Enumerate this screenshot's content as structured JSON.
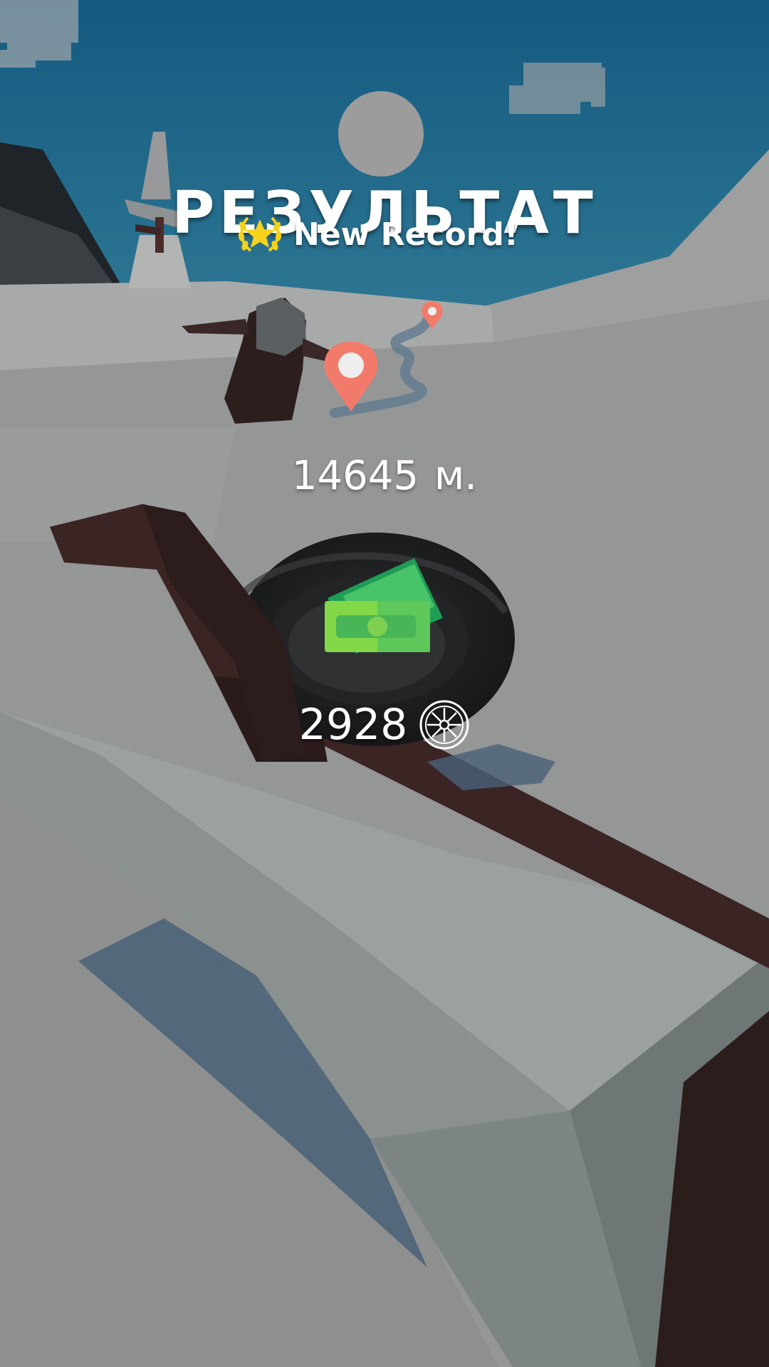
{
  "hud": {
    "title": "РЕЗУЛЬТАТ",
    "record_label": "New Record!",
    "distance_value": "14645",
    "distance_unit": "м.",
    "coins_value": "2928"
  },
  "icons": {
    "record": "laurel-star-icon",
    "reward": "cash-bundle-icon",
    "currency": "tire-wheel-icon",
    "route_marker": "location-pin-icon"
  },
  "colors": {
    "sky": "#175f86",
    "snow": "#9b9c9c",
    "pin": "#f27a6a",
    "cash": "#6ed24e",
    "wood": "#3a2322",
    "tire": "#1d1f20",
    "star": "#f5d21b"
  }
}
